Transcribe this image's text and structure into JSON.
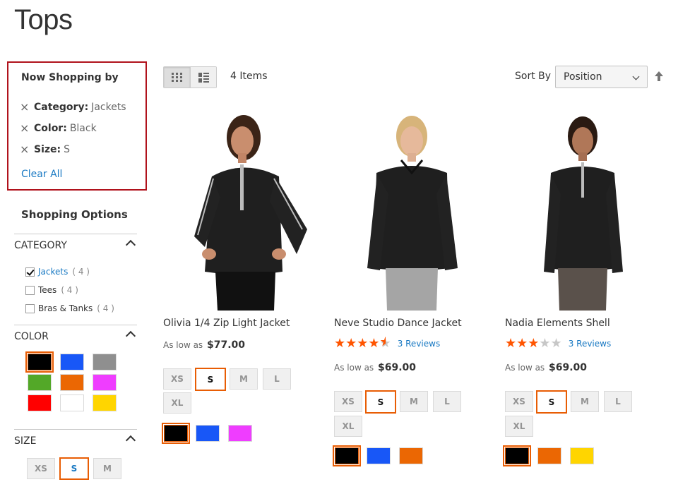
{
  "page": {
    "title": "Tops"
  },
  "now_shopping": {
    "title": "Now Shopping by",
    "filters": [
      {
        "label": "Category:",
        "value": "Jackets"
      },
      {
        "label": "Color:",
        "value": "Black"
      },
      {
        "label": "Size:",
        "value": "S"
      }
    ],
    "clear_all": "Clear All",
    "remove_icon": "×"
  },
  "shopping_options": {
    "title": "Shopping Options",
    "category": {
      "label": "CATEGORY",
      "items": [
        {
          "name": "Jackets",
          "count": "( 4 )",
          "checked": true
        },
        {
          "name": "Tees",
          "count": "( 4 )",
          "checked": false
        },
        {
          "name": "Bras & Tanks",
          "count": "( 4 )",
          "checked": false
        }
      ]
    },
    "color": {
      "label": "COLOR",
      "swatches": [
        "#000000",
        "#1857f7",
        "#8f8f8f",
        "#53a828",
        "#eb6703",
        "#ef3dff",
        "#ff0000",
        "#ffffff",
        "#ffd500"
      ],
      "selected": "#000000"
    },
    "size": {
      "label": "SIZE",
      "options": [
        "XS",
        "S",
        "M"
      ],
      "selected": "S"
    }
  },
  "toolbar": {
    "items_count": "4 Items",
    "sort_label": "Sort By",
    "sort_value": "Position",
    "grid_icon": "grid-view-icon",
    "list_icon": "list-view-icon"
  },
  "products": [
    {
      "name": "Olivia 1/4 Zip Light Jacket",
      "price_prefix": "As low as",
      "price": "$77.00",
      "rating": null,
      "reviews": "",
      "sizes": [
        "XS",
        "S",
        "M",
        "L",
        "XL"
      ],
      "selected_size": "S",
      "colors": [
        "#000000",
        "#1857f7",
        "#ef3dff"
      ]
    },
    {
      "name": "Neve Studio Dance Jacket",
      "price_prefix": "As low as",
      "price": "$69.00",
      "rating": 4.5,
      "reviews": "3 Reviews",
      "sizes": [
        "XS",
        "S",
        "M",
        "L",
        "XL"
      ],
      "selected_size": "S",
      "colors": [
        "#000000",
        "#1857f7",
        "#eb6703"
      ]
    },
    {
      "name": "Nadia Elements Shell",
      "price_prefix": "As low as",
      "price": "$69.00",
      "rating": 3,
      "reviews": "3 Reviews",
      "sizes": [
        "XS",
        "S",
        "M",
        "L",
        "XL"
      ],
      "selected_size": "S",
      "colors": [
        "#000000",
        "#eb6703",
        "#ffd500"
      ]
    }
  ],
  "colors": {
    "accent_orange": "#e85d04",
    "link_blue": "#1979c3",
    "highlight_red": "#b0121c",
    "star_orange": "#ff5501",
    "star_grey": "#c7c7c7"
  }
}
